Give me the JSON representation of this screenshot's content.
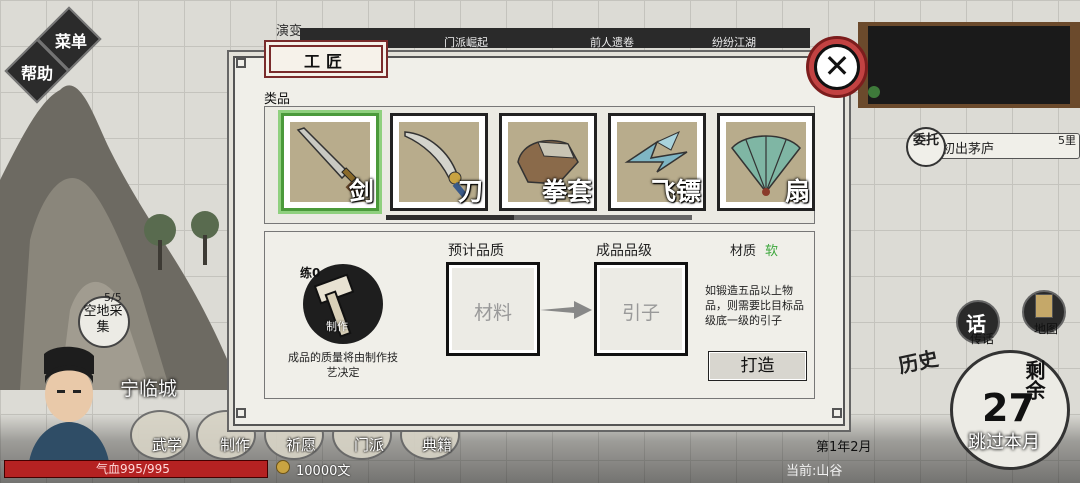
{
  "top_menu": {
    "menu_label": "菜单",
    "help_label": "帮助"
  },
  "journey": {
    "title": "演变",
    "items": [
      "门派崛起",
      "前人遗卷",
      "纷纷江湖"
    ]
  },
  "quest": {
    "badge": "委托",
    "title": "初出茅庐",
    "distance": "5里"
  },
  "right_buttons": {
    "talk": "传话",
    "talk_glyph": "话",
    "map": "地图",
    "history": "历史"
  },
  "remaining": {
    "label": "剩余",
    "value": "27",
    "skip": "跳过本月"
  },
  "player": {
    "city": "宁临城",
    "hp_label": "气血995/995",
    "hp_fraction": 1.0,
    "money": "10000文"
  },
  "gather": {
    "count": "5/5",
    "label": "空地采集"
  },
  "bottom_nav": [
    "武学",
    "制作",
    "祈愿",
    "门派",
    "典籍"
  ],
  "date": "第1年2月",
  "location": "当前:山谷",
  "modal": {
    "title": "工匠",
    "close_glyph": "✕",
    "category_label": "类品",
    "categories": [
      {
        "name": "剑",
        "selected": true
      },
      {
        "name": "刀",
        "selected": false
      },
      {
        "name": "拳套",
        "selected": false
      },
      {
        "name": "飞镖",
        "selected": false
      },
      {
        "name": "扇",
        "selected": false
      }
    ],
    "skill_level": "练0",
    "craft_tag": "制作",
    "quality_note": "成品的质量将由制作技艺决定",
    "expected_quality_title": "预计品质",
    "expected_quality_slot": "材料",
    "output_grade_title": "成品品级",
    "output_grade_slot": "引子",
    "material_label": "材质",
    "material_value": "软",
    "material_note": "如锻造五品以上物品，则需要比目标品级底一级的引子",
    "forge_button": "打造"
  },
  "colors": {
    "selected": "#4b9a3b",
    "hp": "#a21c1c",
    "close": "#c24242",
    "material_value": "#3aa63a"
  }
}
